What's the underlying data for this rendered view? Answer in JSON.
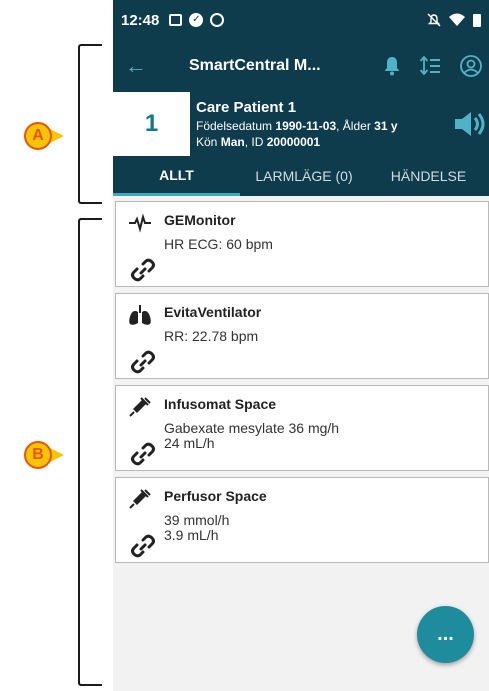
{
  "status_bar": {
    "time": "12:48"
  },
  "toolbar": {
    "title": "SmartCentral M..."
  },
  "patient": {
    "bed": "1",
    "name": "Care Patient 1",
    "dob_label": "Födelsedatum",
    "dob": "1990-11-03",
    "age_label": "Ålder",
    "age": "31 y",
    "sex_label": "Kön",
    "sex": "Man",
    "id_label": "ID",
    "id": "20000001"
  },
  "tabs": [
    {
      "label": "ALLT",
      "active": true
    },
    {
      "label": "LARMLÄGE (0)",
      "active": false
    },
    {
      "label": "HÄNDELSE",
      "active": false
    }
  ],
  "devices": [
    {
      "name": "GEMonitor",
      "icon": "heartbeat-icon",
      "values": [
        "HR ECG: 60 bpm"
      ]
    },
    {
      "name": "EvitaVentilator",
      "icon": "lungs-icon",
      "values": [
        "RR: 22.78 bpm"
      ]
    },
    {
      "name": "Infusomat Space",
      "icon": "syringe-icon",
      "values": [
        "Gabexate mesylate 36 mg/h",
        "24 mL/h"
      ]
    },
    {
      "name": "Perfusor Space",
      "icon": "syringe-icon",
      "values": [
        "39 mmol/h",
        "3.9 mL/h"
      ]
    }
  ],
  "fab": {
    "label": "..."
  },
  "callouts": {
    "a": "A",
    "b": "B"
  },
  "colors": {
    "header": "#0e3c4d",
    "accent": "#1f8c9e",
    "callout_fill": "#f6c400",
    "callout_border": "#e8540b"
  }
}
